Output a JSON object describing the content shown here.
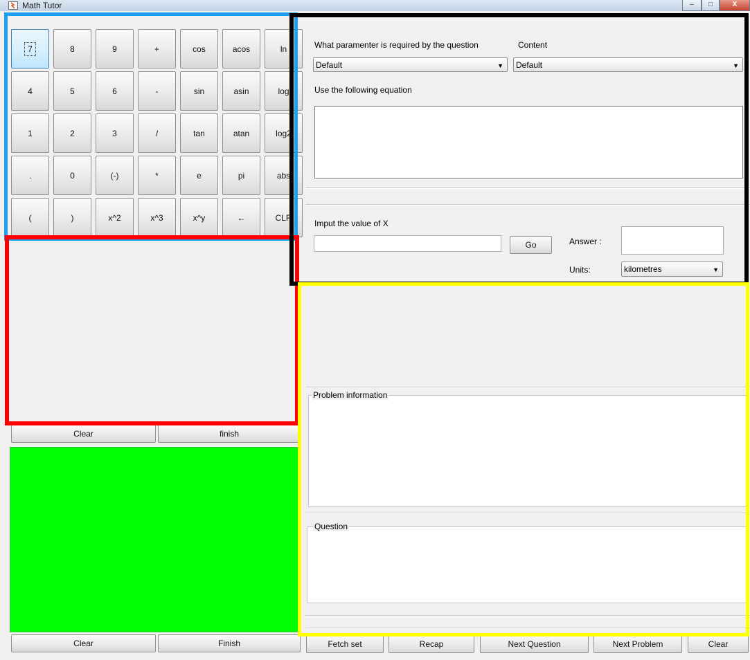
{
  "window": {
    "title": "Math Tutor",
    "controls": {
      "minimize": "–",
      "maximize": "□",
      "close": "X"
    }
  },
  "keypad": {
    "rows": [
      [
        "7",
        "8",
        "9",
        "+",
        "cos",
        "acos",
        "ln"
      ],
      [
        "4",
        "5",
        "6",
        "-",
        "sin",
        "asin",
        "log"
      ],
      [
        "1",
        "2",
        "3",
        "/",
        "tan",
        "atan",
        "log2"
      ],
      [
        ".",
        "0",
        "(-)",
        "*",
        "e",
        "pi",
        "abs"
      ],
      [
        "(",
        ")",
        "x^2",
        "x^3",
        "x^y",
        "←",
        "CLR"
      ]
    ]
  },
  "work_panel": {
    "clear_label": "Clear",
    "finish_label": "finish"
  },
  "green_panel": {
    "clear_label": "Clear",
    "finish_label": "Finish"
  },
  "parameters": {
    "param_label": "What paramenter is required by the question",
    "param_value": "Default",
    "content_label": "Content",
    "content_value": "Default",
    "equation_label": "Use the following equation"
  },
  "input": {
    "x_label": "Imput the value of X",
    "go_label": "Go",
    "answer_label": "Answer :",
    "units_label": "Units:",
    "units_value": "kilometres"
  },
  "info": {
    "problem_title": "Problem information",
    "question_title": "Question"
  },
  "bottom_bar": {
    "fetch": "Fetch set",
    "recap": "Recap",
    "next_question": "Next Question",
    "next_problem": "Next Problem",
    "clear": "Clear"
  },
  "colors": {
    "highlight_blue": "#1ea0f0",
    "highlight_black": "#000000",
    "highlight_red": "#ff0000",
    "highlight_yellow": "#ffff00",
    "green_area": "#00ff00"
  }
}
